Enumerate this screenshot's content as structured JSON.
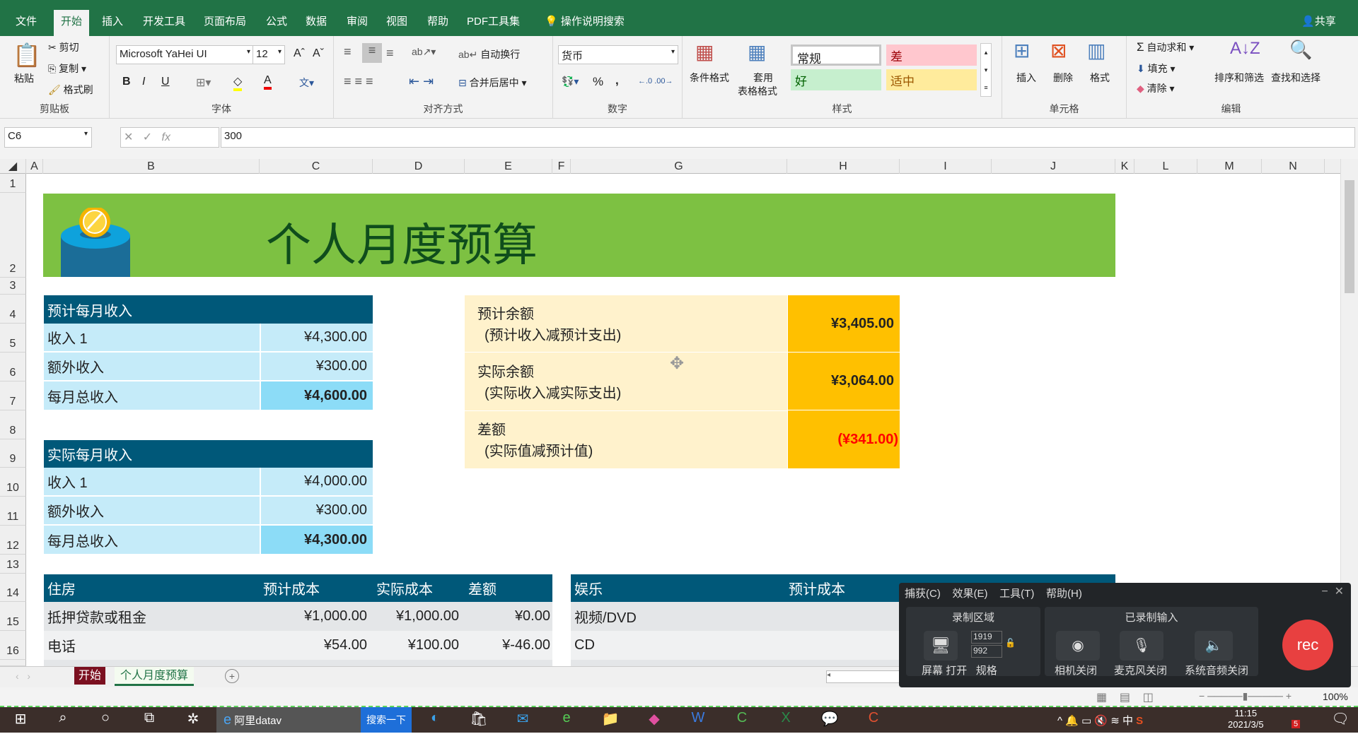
{
  "menu": {
    "tabs": [
      "文件",
      "开始",
      "插入",
      "开发工具",
      "页面布局",
      "公式",
      "数据",
      "审阅",
      "视图",
      "帮助",
      "PDF工具集"
    ],
    "search": "操作说明搜索",
    "share": "共享"
  },
  "ribbon": {
    "clipboard": {
      "paste": "粘贴",
      "cut": "剪切",
      "copy": "复制",
      "format_painter": "格式刷",
      "label": "剪贴板"
    },
    "font": {
      "name": "Microsoft YaHei UI",
      "size": "12",
      "bold": "B",
      "italic": "I",
      "underline": "U",
      "label": "字体"
    },
    "alignment": {
      "wrap": "自动换行",
      "merge": "合并后居中",
      "label": "对齐方式"
    },
    "number": {
      "format": "货币",
      "percent": "%",
      "comma": ",",
      "label": "数字"
    },
    "styles": {
      "conditional": "条件格式",
      "table1": "套用",
      "table2": "表格格式",
      "normal": "常规",
      "bad": "差",
      "good": "好",
      "neutral": "适中",
      "label": "样式"
    },
    "cells": {
      "insert": "插入",
      "delete": "删除",
      "format": "格式",
      "label": "单元格"
    },
    "editing": {
      "autosum": "自动求和",
      "fill": "填充",
      "clear": "清除",
      "sort": "排序和筛选",
      "find": "查找和选择",
      "label": "编辑"
    }
  },
  "formula_bar": {
    "name_box": "C6",
    "value": "300",
    "fx": "fx"
  },
  "columns": [
    "A",
    "B",
    "C",
    "D",
    "E",
    "F",
    "G",
    "H",
    "I",
    "J",
    "K",
    "L",
    "M",
    "N"
  ],
  "rows": [
    "1",
    "2",
    "3",
    "4",
    "5",
    "6",
    "7",
    "8",
    "9",
    "10",
    "11",
    "12",
    "13",
    "14",
    "15",
    "16"
  ],
  "sheet": {
    "title": "个人月度预算",
    "projected_income": {
      "header": "预计每月收入",
      "rows": [
        [
          "收入 1",
          "¥4,300.00"
        ],
        [
          "额外收入",
          "¥300.00"
        ],
        [
          "每月总收入",
          "¥4,600.00"
        ]
      ]
    },
    "actual_income": {
      "header": "实际每月收入",
      "rows": [
        [
          "收入 1",
          "¥4,000.00"
        ],
        [
          "额外收入",
          "¥300.00"
        ],
        [
          "每月总收入",
          "¥4,300.00"
        ]
      ]
    },
    "balance": [
      {
        "label": "预计余额",
        "note": "(预计收入减预计支出)",
        "value": "¥3,405.00"
      },
      {
        "label": "实际余额",
        "note": "(实际收入减实际支出)",
        "value": "¥3,064.00"
      },
      {
        "label": "差额",
        "note": "(实际值减预计值)",
        "value": "(¥341.00)"
      }
    ],
    "housing": {
      "headers": [
        "住房",
        "预计成本",
        "实际成本",
        "差额"
      ],
      "rows": [
        [
          "抵押贷款或租金",
          "¥1,000.00",
          "¥1,000.00",
          "¥0.00"
        ],
        [
          "电话",
          "¥54.00",
          "¥100.00",
          "¥-46.00"
        ]
      ]
    },
    "entertainment": {
      "headers": [
        "娱乐",
        "预计成本"
      ],
      "rows": [
        [
          "视频/DVD"
        ],
        [
          "CD"
        ]
      ]
    }
  },
  "sheet_tabs": [
    "开始",
    "个人月度预算"
  ],
  "status": {
    "zoom": "100%"
  },
  "recorder": {
    "menu": [
      "捕获(C)",
      "效果(E)",
      "工具(T)",
      "帮助(H)"
    ],
    "area_title": "录制区域",
    "inputs_title": "已录制输入",
    "screen": "屏幕",
    "open": "打开",
    "spec": "规格",
    "width": "1919",
    "height": "992",
    "camera": "相机关闭",
    "mic": "麦克风关闭",
    "audio": "系统音频关闭",
    "rec": "rec"
  },
  "taskbar": {
    "browser": "阿里datav",
    "search": "搜索一下",
    "time": "11:15",
    "date": "2021/3/5",
    "ime": "中",
    "badge": "5"
  },
  "colors": {
    "excel_green": "#217346",
    "header_blue": "#005879",
    "banner": "#7dc142",
    "gold": "#ffc000",
    "red": "#ff0000"
  }
}
